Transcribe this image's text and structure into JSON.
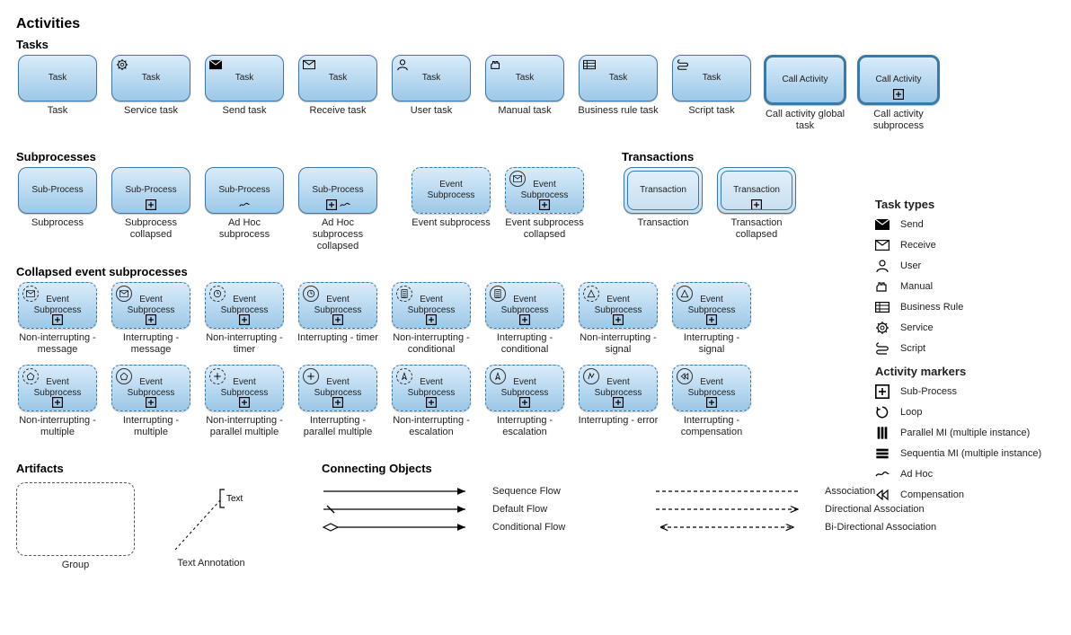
{
  "titles": {
    "activities": "Activities",
    "tasks": "Tasks",
    "subprocesses": "Subprocesses",
    "transactions": "Transactions",
    "collapsed": "Collapsed event subprocesses",
    "artifacts": "Artifacts",
    "connecting": "Connecting Objects",
    "taskTypes": "Task types",
    "activityMarkers": "Activity markers"
  },
  "tasks": [
    {
      "label": "Task",
      "cap": "Task"
    },
    {
      "label": "Task",
      "cap": "Service task"
    },
    {
      "label": "Task",
      "cap": "Send task"
    },
    {
      "label": "Task",
      "cap": "Receive task"
    },
    {
      "label": "Task",
      "cap": "User task"
    },
    {
      "label": "Task",
      "cap": "Manual task"
    },
    {
      "label": "Task",
      "cap": "Business rule task"
    },
    {
      "label": "Task",
      "cap": "Script task"
    },
    {
      "label": "Call Activity",
      "cap": "Call activity global task"
    },
    {
      "label": "Call Activity",
      "cap": "Call activity subprocess"
    }
  ],
  "subprocesses": [
    {
      "label": "Sub-Process",
      "cap": "Subprocess"
    },
    {
      "label": "Sub-Process",
      "cap": "Subprocess collapsed"
    },
    {
      "label": "Sub-Process",
      "cap": "Ad Hoc subprocess"
    },
    {
      "label": "Sub-Process",
      "cap": "Ad Hoc subprocess collapsed"
    }
  ],
  "eventSub": [
    {
      "label": "Event Subprocess",
      "cap": "Event subprocess"
    },
    {
      "label": "Event Subprocess",
      "cap": "Event subprocess collapsed"
    }
  ],
  "transactions": [
    {
      "label": "Transaction",
      "cap": "Transaction"
    },
    {
      "label": "Transaction",
      "cap": "Transaction collapsed"
    }
  ],
  "collapsed1": [
    {
      "label": "Event Subprocess",
      "cap": "Non-interrupting - message"
    },
    {
      "label": "Event Subprocess",
      "cap": "Interrupting - message"
    },
    {
      "label": "Event Subprocess",
      "cap": "Non-interrupting - timer"
    },
    {
      "label": "Event Subprocess",
      "cap": "Interrupting - timer"
    },
    {
      "label": "Event Subprocess",
      "cap": "Non-interrupting - conditional"
    },
    {
      "label": "Event Subprocess",
      "cap": "Interrupting - conditional"
    },
    {
      "label": "Event Subprocess",
      "cap": "Non-interrupting - signal"
    },
    {
      "label": "Event Subprocess",
      "cap": "Interrupting - signal"
    }
  ],
  "collapsed2": [
    {
      "label": "Event Subprocess",
      "cap": "Non-interrupting - multiple"
    },
    {
      "label": "Event Subprocess",
      "cap": "Interrupting -  multiple"
    },
    {
      "label": "Event Subprocess",
      "cap": "Non-interrupting - parallel multiple"
    },
    {
      "label": "Event Subprocess",
      "cap": "Interrupting - parallel multiple"
    },
    {
      "label": "Event Subprocess",
      "cap": "Non-interrupting - escalation"
    },
    {
      "label": "Event Subprocess",
      "cap": "Interrupting - escalation"
    },
    {
      "label": "Event Subprocess",
      "cap": "Interrupting - error"
    },
    {
      "label": "Event Subprocess",
      "cap": "Interrupting - compensation"
    }
  ],
  "artifacts": {
    "group": "Group",
    "text": "Text",
    "textAnnotation": "Text Annotation"
  },
  "flows": {
    "sequence": "Sequence Flow",
    "default": "Default Flow",
    "conditional": "Conditional Flow",
    "association": "Association",
    "directional": "Directional Association",
    "bidirectional": "Bi-Directional Association"
  },
  "taskTypeLegend": [
    "Send",
    "Receive",
    "User",
    "Manual",
    "Business Rule",
    "Service",
    "Script"
  ],
  "markerLegend": [
    "Sub-Process",
    "Loop",
    "Parallel MI (multiple instance)",
    "Sequentia MI (multiple instance)",
    "Ad Hoc",
    "Compensation"
  ]
}
